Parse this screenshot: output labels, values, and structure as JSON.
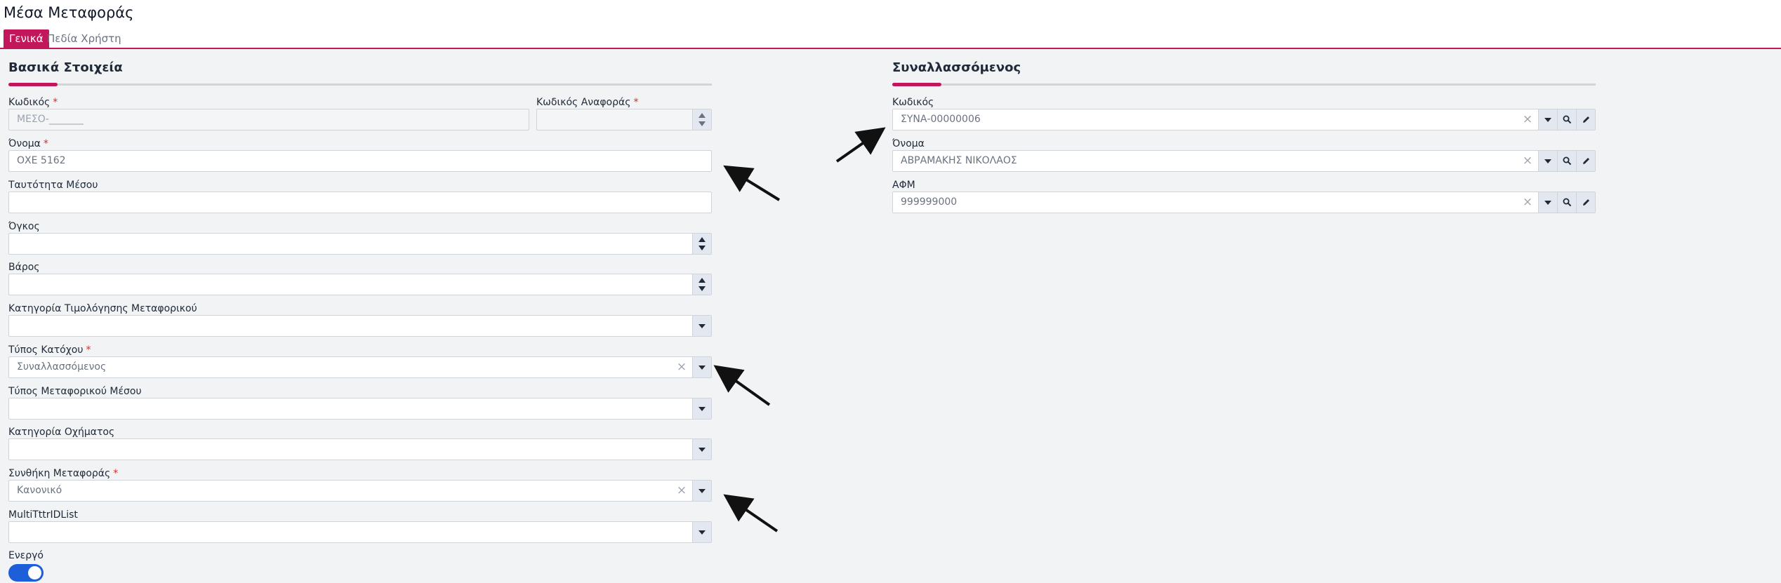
{
  "page_title": "Μέσα Μεταφοράς",
  "tabs": [
    {
      "label": "Γενικά",
      "active": true
    },
    {
      "label": "Πεδία Χρήστη",
      "active": false
    }
  ],
  "basic": {
    "section_title": "Βασικά Στοιχεία",
    "code_label": "Κωδικός",
    "code_value": "ΜΕΣΟ-_______",
    "refcode_label": "Κωδικός Αναφοράς",
    "refcode_value": "",
    "name_label": "Όνομα",
    "name_value": "ΟΧΕ 5162",
    "identity_label": "Ταυτότητα Μέσου",
    "identity_value": "",
    "volume_label": "Όγκος",
    "volume_value": "",
    "weight_label": "Βάρος",
    "weight_value": "",
    "pricing_label": "Κατηγορία Τιμολόγησης Μεταφορικού",
    "pricing_value": "",
    "owner_type_label": "Τύπος Κατόχου",
    "owner_type_value": "Συναλλασσόμενος",
    "vehicle_type_label": "Τύπος Μεταφορικού Μέσου",
    "vehicle_type_value": "",
    "vehicle_cat_label": "Κατηγορία Οχήματος",
    "vehicle_cat_value": "",
    "condition_label": "Συνθήκη Μεταφοράς",
    "condition_value": "Κανονικό",
    "multi_label": "MultiTttrIDList",
    "multi_value": "",
    "active_label": "Ενεργό",
    "active": true
  },
  "party": {
    "section_title": "Συναλλασσόμενος",
    "code_label": "Κωδικός",
    "code_value": "ΣΥΝΑ-00000006",
    "name_label": "Όνομα",
    "name_value": "ΑΒΡΑΜΑΚΗΣ ΝΙΚΟΛΑΟΣ",
    "afm_label": "ΑΦΜ",
    "afm_value": "999999000"
  },
  "colors": {
    "accent": "#c2185b",
    "toggle_on": "#1d5fd8",
    "required": "#d32f2f"
  },
  "icons": {
    "clear": "×",
    "search": "search-icon",
    "edit": "pencil-icon",
    "dropdown": "chevron-down-icon"
  }
}
